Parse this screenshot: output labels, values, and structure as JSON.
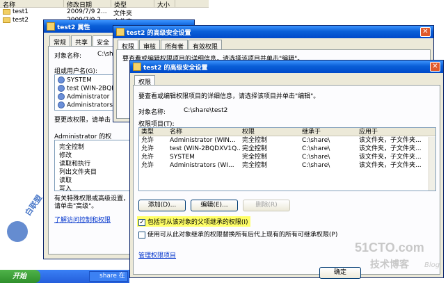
{
  "explorer": {
    "columns": [
      "名称",
      "修改日期",
      "类型",
      "大小"
    ],
    "rows": [
      {
        "name": "test1",
        "date": "2009/7/9 2...",
        "type": "文件夹"
      },
      {
        "name": "test2",
        "date": "2009/7/9 2...",
        "type": "文件夹"
      }
    ]
  },
  "properties": {
    "title": "test2 属性",
    "tabs": [
      "常规",
      "共享",
      "安全"
    ],
    "object_label": "对象名称:",
    "object_value": "C:\\sh",
    "group_label": "组或用户名(G):",
    "users": [
      {
        "name": "SYSTEM"
      },
      {
        "name": "test (WIN-2BQD"
      },
      {
        "name": "Administrator"
      },
      {
        "name": "Administrators"
      }
    ],
    "change_hint": "要更改权限，请单击",
    "perm_for": "Administrator 的权",
    "perms": [
      "完全控制",
      "修改",
      "读取和执行",
      "列出文件夹目",
      "读取",
      "写入"
    ],
    "special_hint": "有关特殊权限或高级设置，请单击\"高级\"。",
    "access_link": "了解访问控制和权限"
  },
  "advanced_back": {
    "title": "test2 的高级安全设置",
    "tabs": [
      "权限",
      "审核",
      "所有者",
      "有效权限"
    ],
    "hint": "要查看或编辑权限项目的详细信息，请选择该项目并单击\"编辑\"。"
  },
  "advanced": {
    "title": "test2 的高级安全设置",
    "tab": "权限",
    "hint": "要查看或编辑权限项目的详细信息，请选择该项目并单击\"编辑\"。",
    "object_label": "对象名称:",
    "object_value": "C:\\share\\test2",
    "entries_label": "权限项目(T):",
    "columns": [
      "类型",
      "名称",
      "权限",
      "继承于",
      "应用于"
    ],
    "entries": [
      {
        "type": "允许",
        "name": "Administrator (WIN...",
        "perm": "完全控制",
        "inherit": "C:\\share\\",
        "apply": "该文件夹，子文件夹..."
      },
      {
        "type": "允许",
        "name": "test (WIN-2BQDXV1Q...",
        "perm": "完全控制",
        "inherit": "C:\\share\\",
        "apply": "该文件夹，子文件夹..."
      },
      {
        "type": "允许",
        "name": "SYSTEM",
        "perm": "完全控制",
        "inherit": "C:\\share\\",
        "apply": "该文件夹，子文件夹..."
      },
      {
        "type": "允许",
        "name": "Administrators (WI...",
        "perm": "完全控制",
        "inherit": "C:\\share\\",
        "apply": "该文件夹，子文件夹..."
      }
    ],
    "add_label": "添加(D)...",
    "edit_label": "编辑(E)...",
    "delete_label": "删除(R)",
    "inherit_label": "包括可从该对象的父项继承的权限(I)",
    "replace_label": "使用可从此对象继承的权限替换所有后代上现有的所有可继承权限(P)",
    "manage_link": "管理权限项目",
    "ok_label": "确定"
  },
  "taskbar": {
    "start": "开始",
    "item": "share 在"
  },
  "watermark": {
    "left": "白联盟",
    "right_main": "51CTO.com",
    "right_sub": "技术博客",
    "right_blog": "Blog"
  }
}
